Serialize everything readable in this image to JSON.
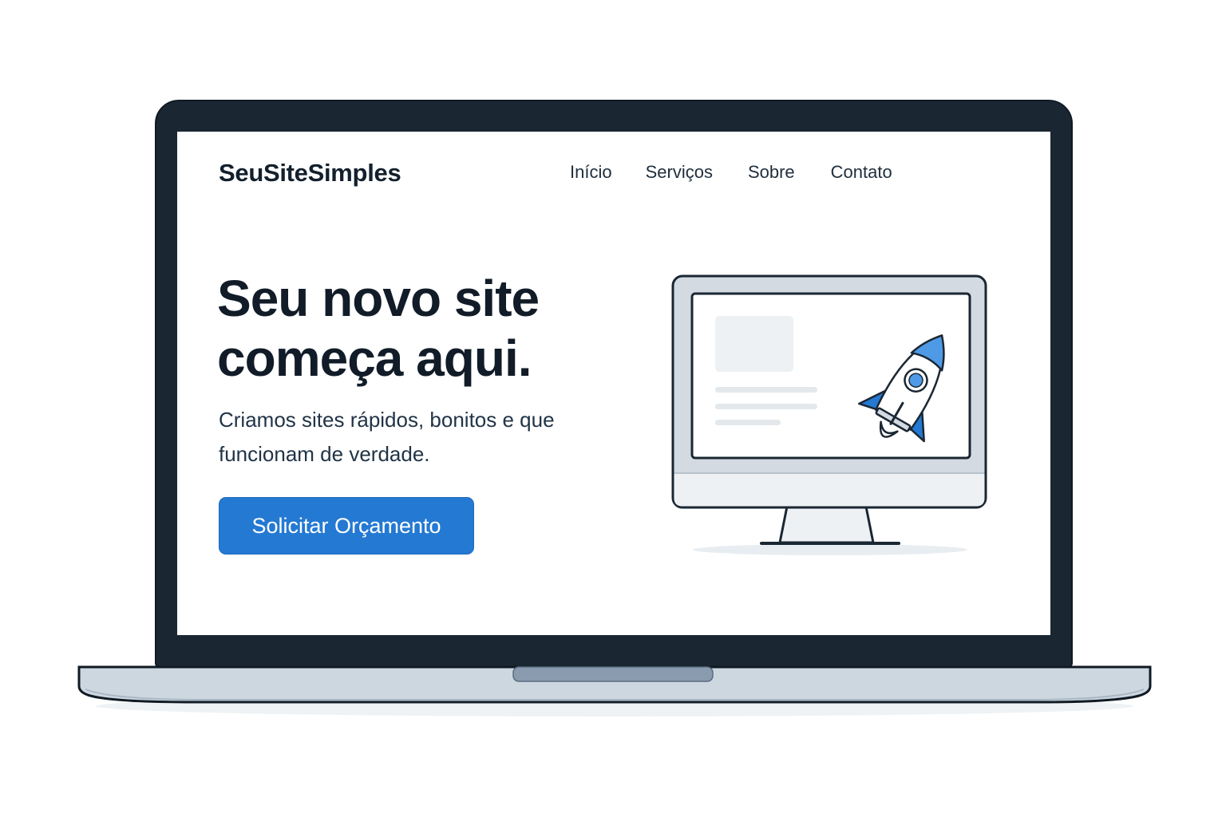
{
  "site": {
    "brand": "SeuSiteSimples",
    "nav": [
      {
        "label": "Início"
      },
      {
        "label": "Serviços"
      },
      {
        "label": "Sobre"
      },
      {
        "label": "Contato"
      }
    ]
  },
  "hero": {
    "title": "Seu novo site começa aqui.",
    "subtitle": "Criamos sites rápidos, bonitos e que funcionam de verdade.",
    "cta_label": "Solicitar Orçamento"
  },
  "illustration": {
    "icons": [
      "monitor-icon",
      "rocket-icon"
    ]
  },
  "colors": {
    "accent": "#2479d2",
    "text_dark": "#111c28",
    "laptop_frame": "#1a2733",
    "laptop_base": "#cdd7e0"
  }
}
